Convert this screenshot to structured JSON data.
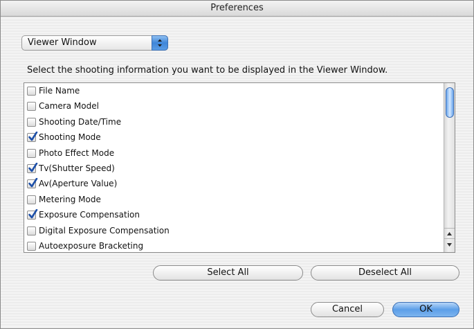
{
  "window": {
    "title": "Preferences"
  },
  "popup": {
    "selected": "Viewer Window"
  },
  "instruction": "Select the shooting information you want to be displayed in the Viewer Window.",
  "items": [
    {
      "label": "File Name",
      "checked": false
    },
    {
      "label": "Camera Model",
      "checked": false
    },
    {
      "label": "Shooting Date/Time",
      "checked": false
    },
    {
      "label": "Shooting Mode",
      "checked": true
    },
    {
      "label": "Photo Effect Mode",
      "checked": false
    },
    {
      "label": "Tv(Shutter Speed)",
      "checked": true
    },
    {
      "label": "Av(Aperture Value)",
      "checked": true
    },
    {
      "label": "Metering Mode",
      "checked": false
    },
    {
      "label": "Exposure Compensation",
      "checked": true
    },
    {
      "label": "Digital Exposure Compensation",
      "checked": false
    },
    {
      "label": "Autoexposure Bracketing",
      "checked": false
    }
  ],
  "buttons": {
    "select_all": "Select All",
    "deselect_all": "Deselect All",
    "cancel": "Cancel",
    "ok": "OK"
  }
}
